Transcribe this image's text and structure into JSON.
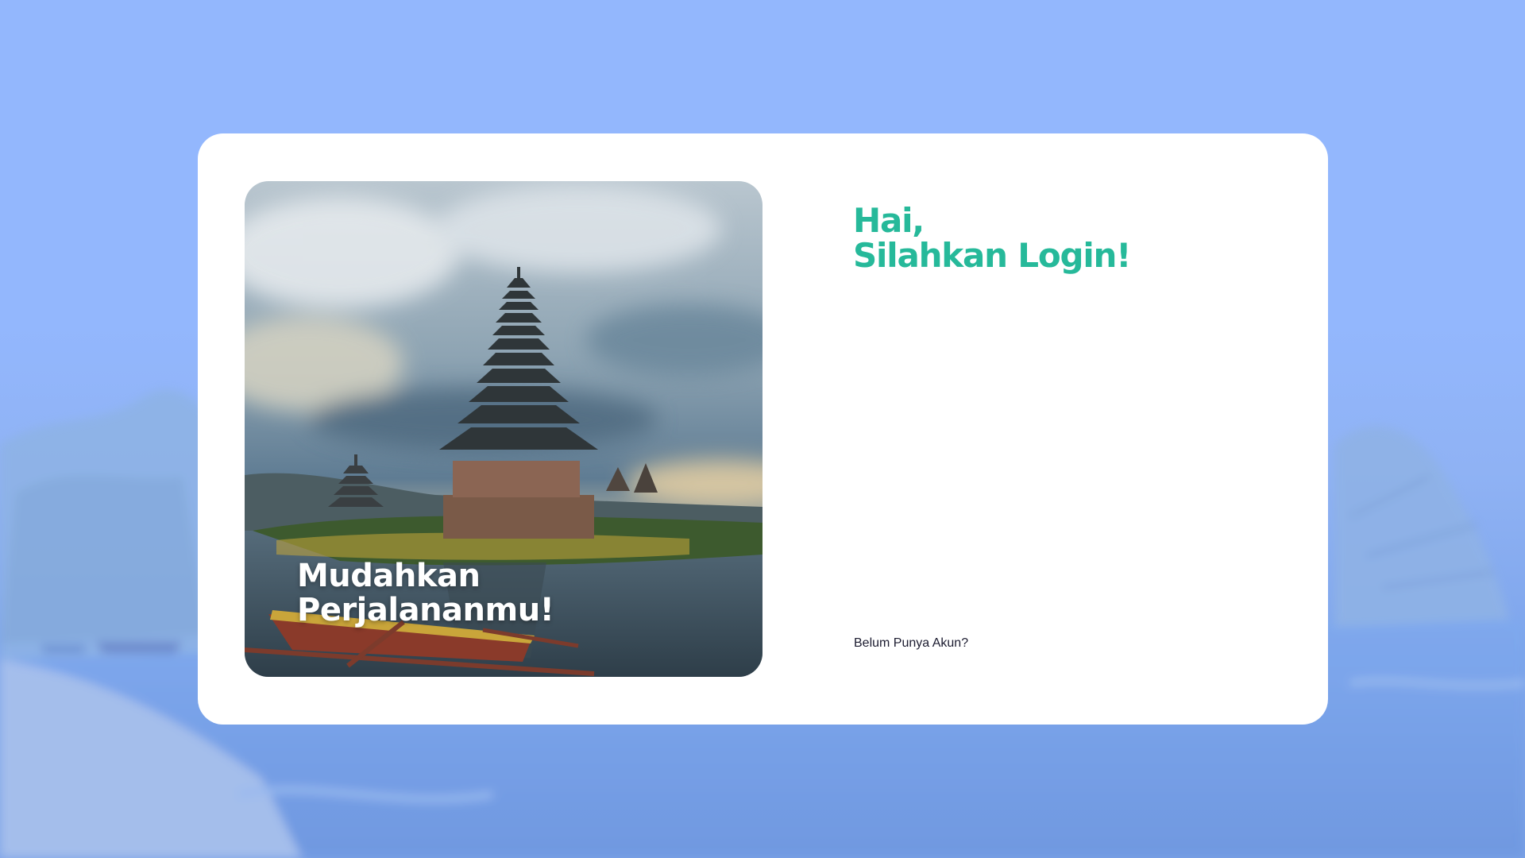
{
  "hero": {
    "caption_line1": "Mudahkan",
    "caption_line2": "Perjalananmu!"
  },
  "login": {
    "greeting_line1": "Hai,",
    "greeting_line2": "Silahkan Login!",
    "signup_prompt": "Belum Punya Akun?"
  },
  "colors": {
    "accent": "#26b99a",
    "page_background": "#93b7fd",
    "card_background": "#ffffff",
    "caption_text": "#ffffff"
  }
}
